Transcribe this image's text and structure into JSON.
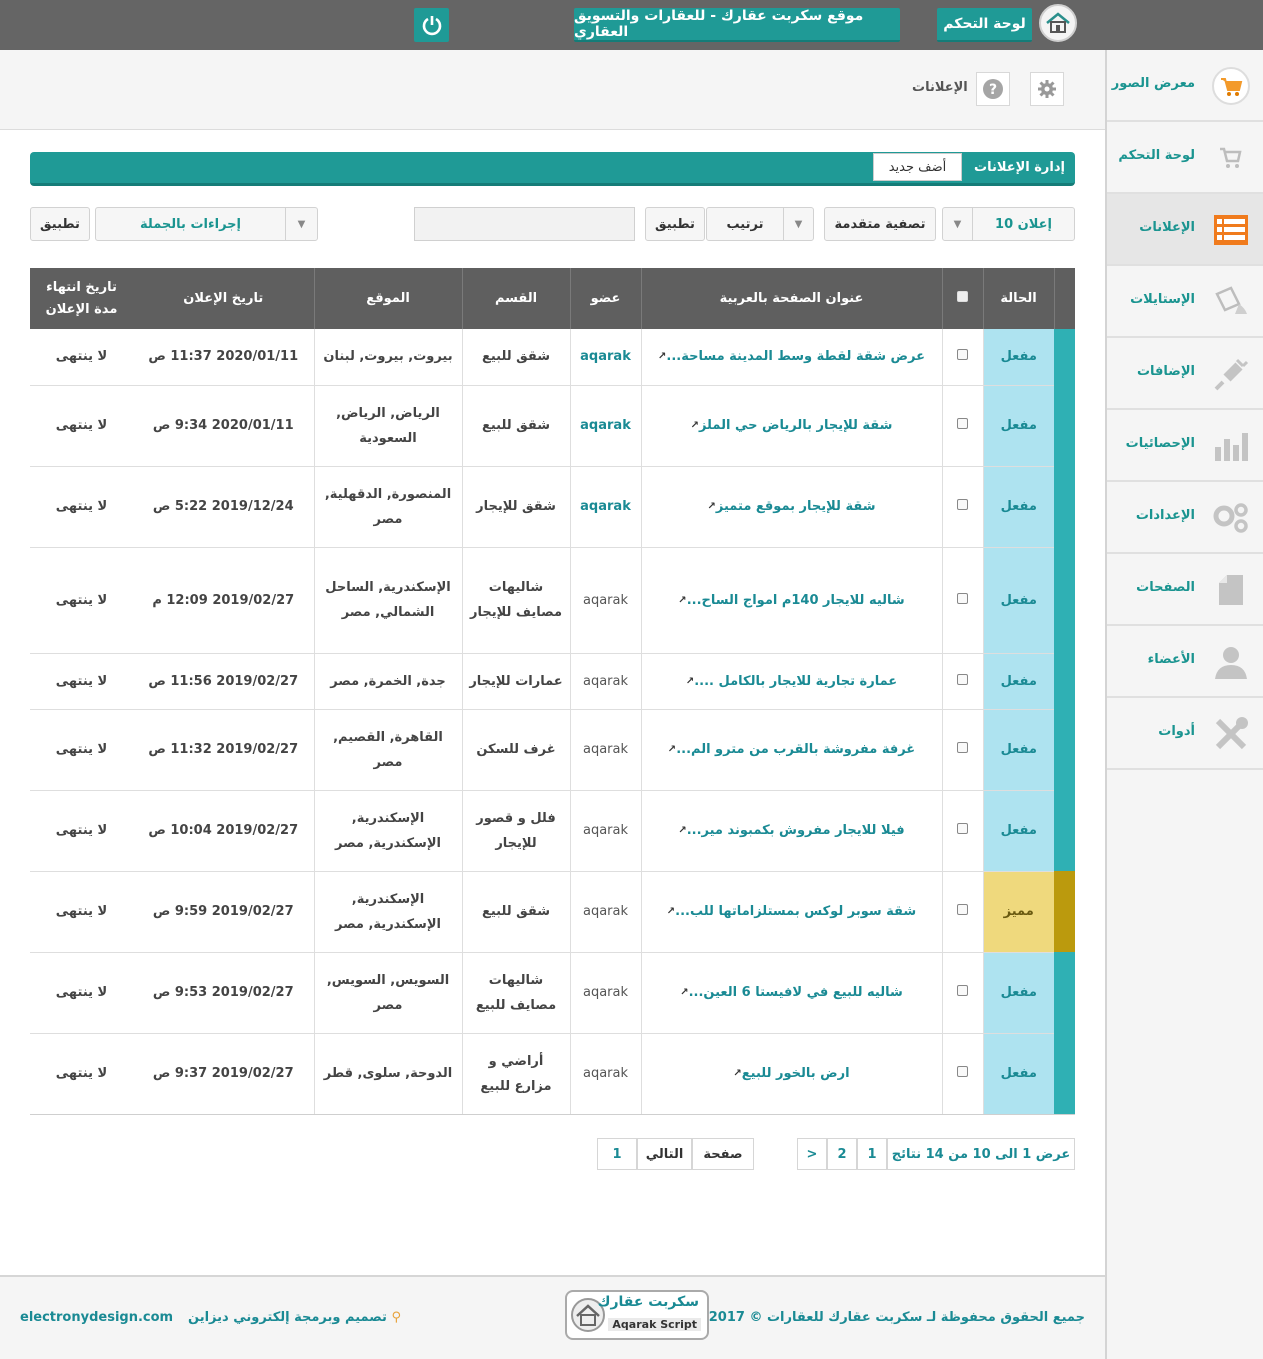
{
  "topbar": {
    "dashboard_label": "لوحة التحكم",
    "site_label": "موقع سكربت عقارك - للعقارات والتسويق العقاري"
  },
  "sidebar": {
    "items": [
      {
        "label": "معرض الصور",
        "icon": "cart-icon"
      },
      {
        "label": "لوحة التحكم",
        "icon": "cart-outline-icon"
      },
      {
        "label": "الإعلانات",
        "icon": "list-icon"
      },
      {
        "label": "الإستايلات",
        "icon": "paint-bucket-icon"
      },
      {
        "label": "الإضافات",
        "icon": "plug-icon"
      },
      {
        "label": "الإحصائيات",
        "icon": "bar-chart-icon"
      },
      {
        "label": "الإعدادات",
        "icon": "gears-icon"
      },
      {
        "label": "الصفحات",
        "icon": "page-icon"
      },
      {
        "label": "الأعضاء",
        "icon": "user-icon"
      },
      {
        "label": "أدوات",
        "icon": "tools-icon"
      }
    ]
  },
  "header": {
    "breadcrumb": "الإعلانات"
  },
  "panel": {
    "title": "إدارة الإعلانات",
    "add_new": "أضف جديد"
  },
  "controls": {
    "per_page": "10 إعلان",
    "advanced_filter": "تصفية متقدمة",
    "sort": "ترتيب",
    "apply_sort": "تطبيق",
    "bulk_actions": "إجراءات بالجملة",
    "apply_bulk": "تطبيق"
  },
  "table": {
    "headers": {
      "status": "الحالة",
      "title": "عنوان الصفحة بالعربية",
      "member": "عضو",
      "category": "القسم",
      "location": "الموقع",
      "date": "تاريخ الإعلان",
      "expire": "تاريخ انتهاء مدة الإعلان"
    },
    "rows": [
      {
        "status": "مفعل",
        "title": "عرض شقة لقطة وسط المدينة مساحة...",
        "member": "aqarak",
        "category": "شقق للبيع",
        "location": "بيروت, بيروت, لبنان",
        "date": "2020/01/11 11:37 ص",
        "expire": "لا ينتهى"
      },
      {
        "status": "مفعل",
        "title": "شقة للإيجار بالرياض حي الملز",
        "member": "aqarak",
        "category": "شقق للبيع",
        "location": "الرياض, الرياض, السعودية",
        "date": "2020/01/11 9:34 ص",
        "expire": "لا ينتهى"
      },
      {
        "status": "مفعل",
        "title": "شقة للإيجار بموقع متميز",
        "member": "aqarak",
        "category": "شقق للإيجار",
        "location": "المنصورة, الدقهلية, مصر",
        "date": "2019/12/24 5:22 ص",
        "expire": "لا ينتهى"
      },
      {
        "status": "مفعل",
        "title": "شاليه للايجار 140م امواج الساح...",
        "member": "aqarak",
        "category": "شاليهات مصايف للإيجار",
        "location": "الإسكندرية, الساحل الشمالي, مصر",
        "date": "2019/02/27 12:09 م",
        "expire": "لا ينتهى"
      },
      {
        "status": "مفعل",
        "title": "عمارة تجارية للايجار بالكامل ....",
        "member": "aqarak",
        "category": "عمارات للإيجار",
        "location": "جدة, الخمرة, مصر",
        "date": "2019/02/27 11:56 ص",
        "expire": "لا ينتهى"
      },
      {
        "status": "مفعل",
        "title": "غرفة مفروشة بالقرب من مترو الم...",
        "member": "aqarak",
        "category": "غرف للسكن",
        "location": "القاهرة, القصيم, مصر",
        "date": "2019/02/27 11:32 ص",
        "expire": "لا ينتهى"
      },
      {
        "status": "مفعل",
        "title": "فيلا للايجار مفروش بكمبوند مير...",
        "member": "aqarak",
        "category": "فلل و قصور للإيجار",
        "location": "الإسكندرية, الإسكندرية, مصر",
        "date": "2019/02/27 10:04 ص",
        "expire": "لا ينتهى"
      },
      {
        "status": "مميز",
        "title": "شقة سوبر لوكس بمستلزاماتها للب...",
        "member": "aqarak",
        "category": "شقق للبيع",
        "location": "الإسكندرية, الإسكندرية, مصر",
        "date": "2019/02/27 9:59 ص",
        "expire": "لا ينتهى"
      },
      {
        "status": "مفعل",
        "title": "شاليه للبيع في لافيستا 6 العين...",
        "member": "aqarak",
        "category": "شاليهات مصايف للبيع",
        "location": "السويس, السويس, مصر",
        "date": "2019/02/27 9:53 ص",
        "expire": "لا ينتهى"
      },
      {
        "status": "مفعل",
        "title": "ارض بالخور للبيع",
        "member": "aqarak",
        "category": "أراضي و مزارع للبيع",
        "location": "الدوحة, سلوى, قطر",
        "date": "2019/02/27 9:37 ص",
        "expire": "لا ينتهى"
      }
    ]
  },
  "pagination": {
    "summary": "عرض 1 الى 10 من 14 نتائج",
    "page1": "1",
    "page2": "2",
    "next_arrow": ">",
    "page_label": "صفحة",
    "next_label": "التالي",
    "goto_value": "1"
  },
  "footer": {
    "copyright": "جميع الحقوق محفوظة لـ سكربت عقارك للعقارات © 2017",
    "logo_ar": "سكربت عقارك",
    "logo_en": "Aqarak Script",
    "design": "تصميم وبرمجة إلكتروني ديزاين",
    "site": "electronydesign.com"
  }
}
